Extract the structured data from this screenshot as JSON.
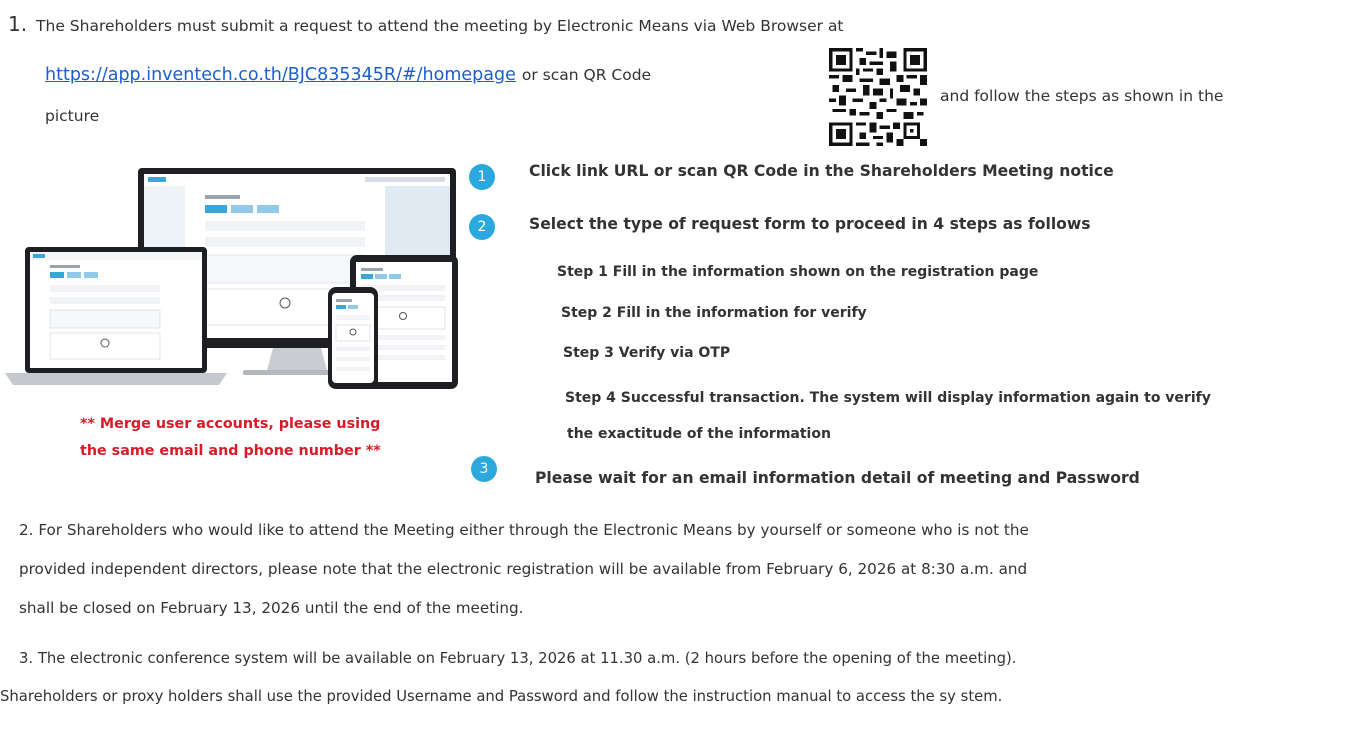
{
  "para1": {
    "number": "1.",
    "line1": "The Shareholders must submit a request to attend the meeting by Electronic Means via Web Browser at",
    "link": "https://app.inventech.co.th/BJC835345R/#/homepage",
    "mid_text": "or scan QR Code",
    "after_qr": "and follow the steps as shown in the",
    "line3": "picture"
  },
  "merge_note": {
    "line1": "** Merge user accounts, please using",
    "line2": "the same email and phone number **"
  },
  "steps": {
    "step1": {
      "badge": "1",
      "text": "Click link URL or scan QR Code in the Shareholders Meeting notice"
    },
    "step2": {
      "badge": "2",
      "text": "Select the type of request form to proceed in 4 steps as follows",
      "sub1": "Step 1 Fill in the information shown on the registration page",
      "sub2": "Step 2 Fill in the information for verify",
      "sub3": "Step 3 Verify via OTP",
      "sub4a": "Step 4 Successful transaction. The system will display information again to verify",
      "sub4b": "the exactitude of the information"
    },
    "step3": {
      "badge": "3",
      "text": "Please wait for an email information detail of meeting and Password"
    }
  },
  "para2": {
    "line1": "2. For Shareholders who would like to attend the Meeting either through the Electronic Means by yourself or someone who is not the",
    "line2": "provided independent directors, please note that the electronic registration will be available from February 6, 2026 at 8:30 a.m. and",
    "line3": "shall be closed on February 13, 2026 until the end of the meeting."
  },
  "para3": {
    "line1": "3. The electronic conference system will be available on February 13, 2026 at 11.30 a.m. (2 hours before the opening of the meeting).",
    "line2": "Shareholders or proxy holders shall use the provided Username and Password and follow the instruction manual to access the sy stem."
  },
  "colors": {
    "link": "#1a5fd0",
    "badge": "#2ba9de",
    "note": "#d81b28"
  }
}
